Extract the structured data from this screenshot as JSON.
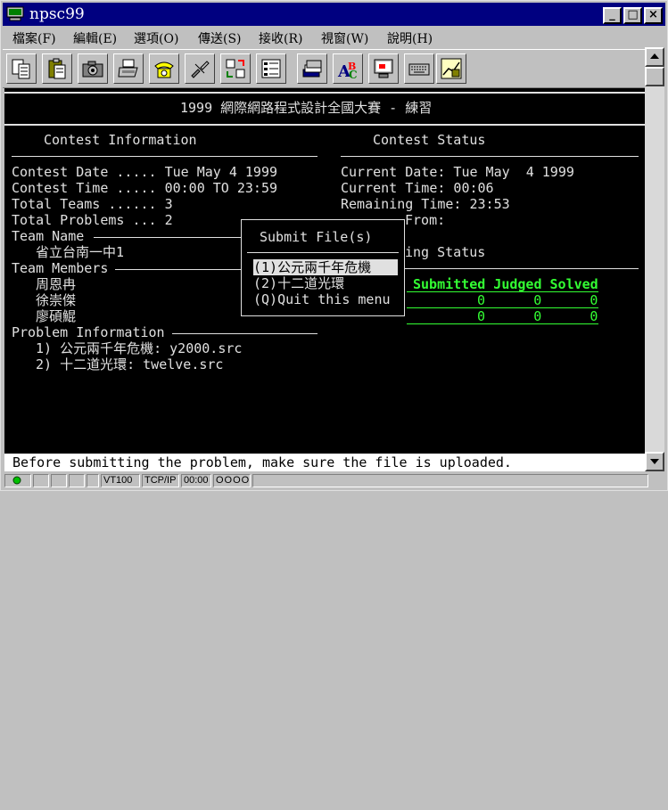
{
  "window": {
    "title": "npsc99",
    "minimize": "_",
    "maximize": "□",
    "close": "×"
  },
  "menu": [
    "檔案(F)",
    "編輯(E)",
    "選項(O)",
    "傳送(S)",
    "接收(R)",
    "視窗(W)",
    "說明(H)"
  ],
  "toolbar": [
    "copy-icon",
    "paste-icon",
    "camera-icon",
    "printer-icon",
    "phone-icon",
    "disconnect-icon",
    "transfer-icon",
    "settings-icon",
    "stack-icon",
    "spell-icon",
    "screen-icon",
    "keyboard-icon",
    "chart-icon"
  ],
  "terminal": {
    "header": "1999 網際網路程式設計全國大賽 - 練習",
    "contest_info_title": "Contest Information",
    "contest_status_title": "Contest Status",
    "contest_date": "Contest Date ..... Tue May 4 1999",
    "contest_time": "Contest Time ..... 00:00 TO 23:59",
    "total_teams": "Total Teams ...... 3",
    "total_problems": "Total Problems ... 2",
    "current_date": "Current Date: Tue May  4 1999",
    "current_time": "Current Time: 00:06",
    "remaining_time": "Remaining Time: 23:53",
    "from_partial": "From:",
    "team_name_label": "Team Name",
    "team_name": "省立台南一中1",
    "team_members_label": "Team Members",
    "members": [
      "周恩冉",
      "徐崇傑",
      "廖碩鯤"
    ],
    "judging_status_partial": "ing Status",
    "status_headers": "Submitted Judged Solved",
    "status_rows": [
      "0      0      0",
      "0      0      0"
    ],
    "problem_info_label": "Problem Information",
    "problems": [
      "1) 公元兩千年危機: y2000.src",
      "2) 十二道光環: twelve.src"
    ],
    "popup": {
      "title": "Submit File(s)",
      "options": [
        "(1)公元兩千年危機",
        "(2)十二道光環",
        "(Q)Quit this menu"
      ]
    },
    "message": " Before submitting the problem, make sure the file is uploaded."
  },
  "statusbar": {
    "emulation": "VT100",
    "protocol": "TCP/IP",
    "timer": "00:00",
    "lights": "OOOO"
  },
  "colors": {
    "terminal_bg": "#000000",
    "terminal_fg": "#e0e0e0",
    "status_green": "#33ff33",
    "titlebar": "#000080"
  }
}
